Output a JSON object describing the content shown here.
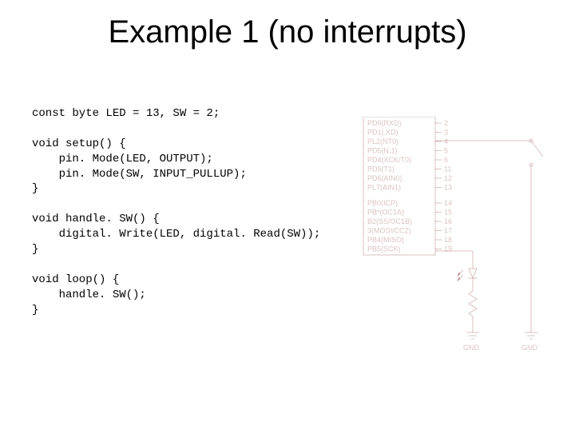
{
  "title": "Example 1 (no interrupts)",
  "code": "const byte LED = 13, SW = 2;\n\nvoid setup() {\n    pin. Mode(LED, OUTPUT);\n    pin. Mode(SW, INPUT_PULLUP);\n}\n\nvoid handle. SW() {\n    digital. Write(LED, digital. Read(SW));\n}\n\nvoid loop() {\n    handle. SW();\n}",
  "schematic": {
    "pin_labels_left": [
      "PD0(RXD)",
      "PD1(.XD)",
      "PL2(NT0)",
      "PD5(N.1)",
      "PD4(XCK/T0)",
      "PD5(T1)",
      "PD6(AIN0)",
      "PL7(AIN1)",
      "",
      "PB0(ICP)",
      "PB*(OC1A)",
      "B2(SS/OC1B)",
      "3(MOSI/CC2)",
      "PB4(MISO)",
      "PB5(SCK)"
    ],
    "pin_numbers_right": [
      "2",
      "3",
      "4",
      "5",
      "6",
      "11",
      "12",
      "13",
      "",
      "14",
      "15",
      "16",
      "17",
      "18",
      "19"
    ],
    "gnd_left": "GND",
    "gnd_right": "GND"
  }
}
